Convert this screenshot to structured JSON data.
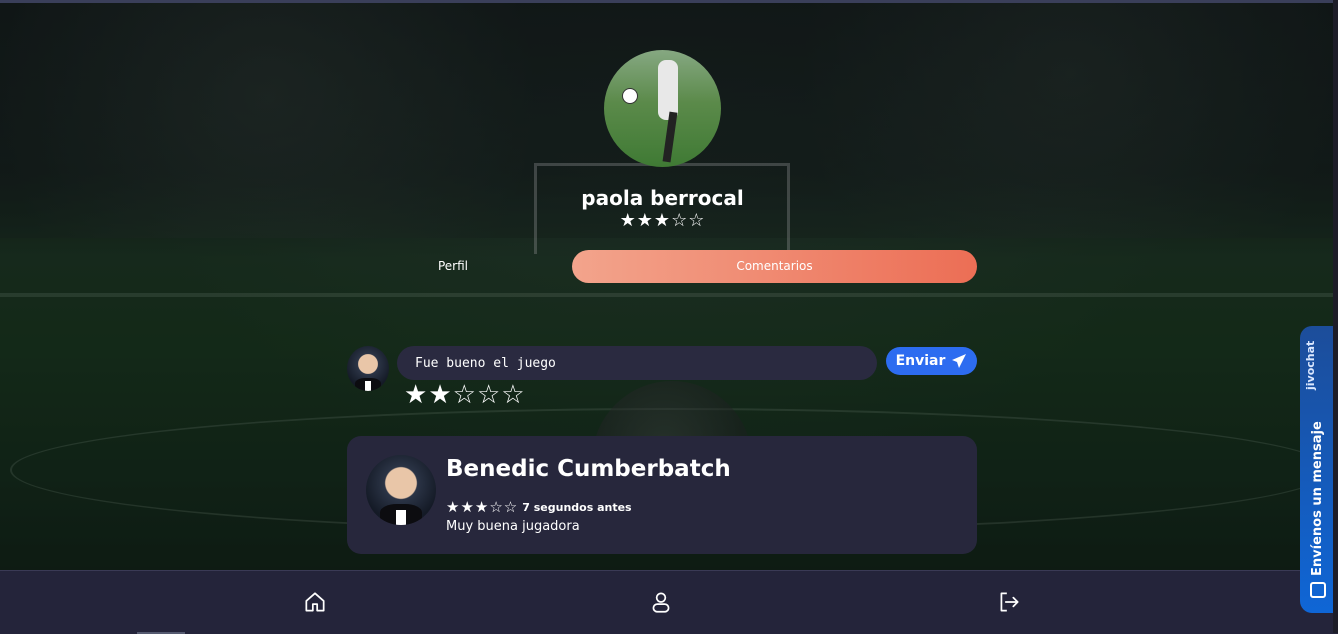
{
  "profile": {
    "name": "paola berrocal",
    "rating": 3,
    "stars_display": "★★★☆☆"
  },
  "tabs": [
    {
      "label": "Perfil",
      "active": false
    },
    {
      "label": "Comentarios",
      "active": true
    }
  ],
  "composer": {
    "value": "Fue bueno el juego",
    "send_label": "Enviar",
    "rating": 2,
    "stars_display": [
      "★",
      "★",
      "☆",
      "☆",
      "☆"
    ]
  },
  "comments": [
    {
      "author": "Benedic Cumberbatch",
      "rating": 3,
      "stars_display": "★★★☆☆",
      "time": "7 segundos antes",
      "text": "Muy buena jugadora"
    }
  ],
  "nav": {
    "items": [
      {
        "icon": "home-icon"
      },
      {
        "icon": "user-icon"
      },
      {
        "icon": "logout-icon"
      }
    ]
  },
  "chat_widget": {
    "brand": "jivochat",
    "label": "Envíenos un mensaje"
  },
  "colors": {
    "accent_tab_start": "#f3a48c",
    "accent_tab_end": "#ec6e55",
    "send_button": "#2d6cf0",
    "card_bg": "#27273c",
    "nav_bg": "#24243a"
  }
}
